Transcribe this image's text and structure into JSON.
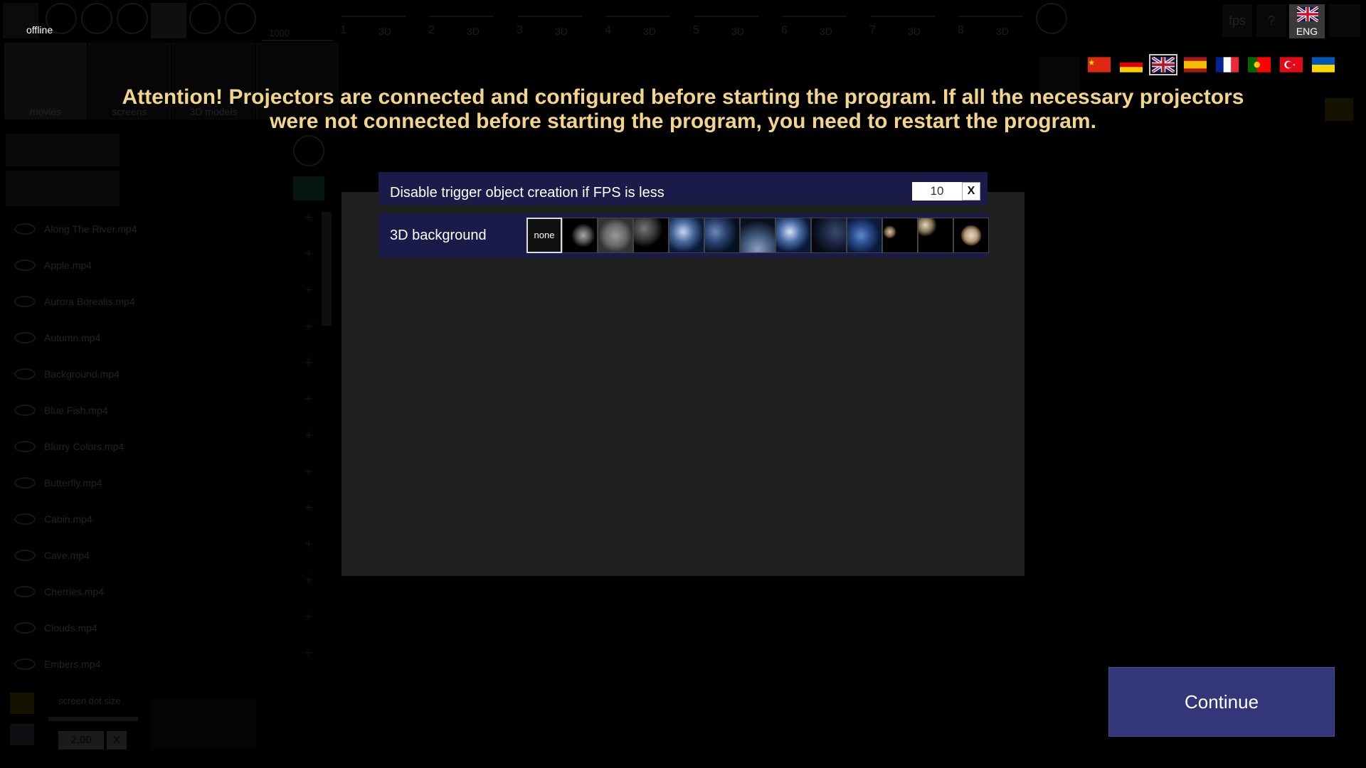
{
  "status": {
    "connection": "offline"
  },
  "toolbar": {
    "counter": "1000",
    "projectors": [
      {
        "num": "1",
        "mode": "3D"
      },
      {
        "num": "2",
        "mode": "3D"
      },
      {
        "num": "3",
        "mode": "3D"
      },
      {
        "num": "4",
        "mode": "3D"
      },
      {
        "num": "5",
        "mode": "3D"
      },
      {
        "num": "6",
        "mode": "3D"
      },
      {
        "num": "7",
        "mode": "3D"
      },
      {
        "num": "8",
        "mode": "3D"
      }
    ],
    "fps_label": "fps",
    "help_label": "?",
    "language": "ENG"
  },
  "tabs": [
    {
      "label": "movies"
    },
    {
      "label": "screens"
    },
    {
      "label": "3D models"
    },
    {
      "label": ""
    }
  ],
  "files": [
    "Along The River.mp4",
    "Apple.mp4",
    "Aurora Borealis.mp4",
    "Autumn.mp4",
    "Background.mp4",
    "Blue Fish.mp4",
    "Blurry Colors.mp4",
    "Butterfly.mp4",
    "Cabin.mp4",
    "Cave.mp4",
    "Cherries.mp4",
    "Clouds.mp4",
    "Embers.mp4"
  ],
  "bottom_panel": {
    "dot_size_label": "screen dot size",
    "dot_size_value": "2,00",
    "dot_size_clear": "X"
  },
  "attention": "Attention! Projectors are connected and configured before starting the program. If all the necessary projectors were not connected before starting the program, you need to restart the program.",
  "flags": [
    "china",
    "germany",
    "united-kingdom",
    "spain",
    "france",
    "portugal",
    "turkey",
    "ukraine"
  ],
  "selected_flag": "united-kingdom",
  "dialog": {
    "fps_label": "Disable trigger object creation if FPS is less",
    "fps_value": "10",
    "fps_clear": "X",
    "bg3d_label": "3D background",
    "bg3d_none": "none",
    "bg3d_options": [
      "moon-dark",
      "moon-grey",
      "moon-crescent",
      "earth-night",
      "earth-dark",
      "earth-horizon",
      "earth-clouds",
      "earth-dark-2",
      "earth-blue",
      "planets-pair",
      "planet-crescent",
      "jupiter"
    ]
  },
  "continue_label": "Continue",
  "colors": {
    "attention": "#f2d48b",
    "dialog_row": "#1b1b4a",
    "continue": "#333678"
  }
}
